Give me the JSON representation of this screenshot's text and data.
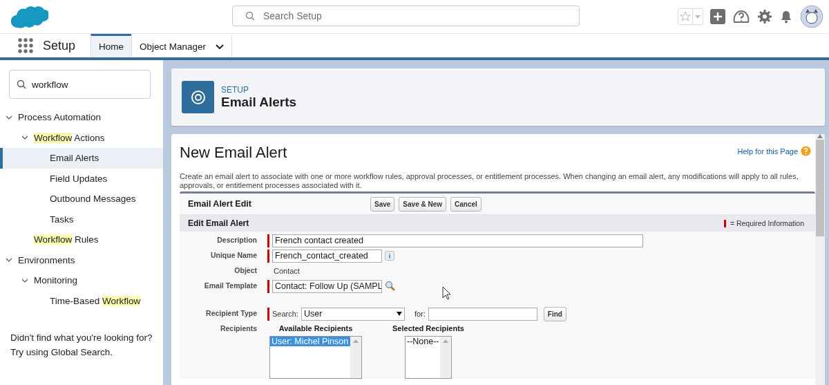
{
  "header": {
    "search": {
      "placeholder": "Search Setup"
    }
  },
  "nav": {
    "app_name": "Setup",
    "tabs": [
      {
        "label": "Home",
        "selected": true,
        "dropdown": false
      },
      {
        "label": "Object Manager",
        "selected": false,
        "dropdown": true
      }
    ]
  },
  "sidebar": {
    "search": {
      "value": "workflow"
    },
    "tree": [
      {
        "label": [
          {
            "text": "Process Automation",
            "highlight": false
          }
        ],
        "expanded": true,
        "selected": false,
        "children": [
          {
            "label": [
              {
                "text": "Workflow",
                "highlight": true
              },
              {
                "text": " Actions",
                "highlight": false
              }
            ],
            "expanded": true,
            "selected": false,
            "children": [
              {
                "label": [
                  {
                    "text": "Email Alerts",
                    "highlight": false
                  }
                ],
                "selected": true
              },
              {
                "label": [
                  {
                    "text": "Field Updates",
                    "highlight": false
                  }
                ],
                "selected": false
              },
              {
                "label": [
                  {
                    "text": "Outbound Messages",
                    "highlight": false
                  }
                ],
                "selected": false
              },
              {
                "label": [
                  {
                    "text": "Tasks",
                    "highlight": false
                  }
                ],
                "selected": false
              }
            ]
          },
          {
            "label": [
              {
                "text": "Workflow",
                "highlight": true
              },
              {
                "text": " Rules",
                "highlight": false
              }
            ],
            "selected": false
          }
        ]
      },
      {
        "label": [
          {
            "text": "Environments",
            "highlight": false
          }
        ],
        "expanded": true,
        "selected": false,
        "children": [
          {
            "label": [
              {
                "text": "Monitoring",
                "highlight": false
              }
            ],
            "expanded": true,
            "selected": false,
            "children": [
              {
                "label": [
                  {
                    "text": "Time-Based ",
                    "highlight": false
                  },
                  {
                    "text": "Workflow",
                    "highlight": true
                  }
                ],
                "selected": false
              }
            ]
          }
        ]
      }
    ],
    "footer": [
      "Didn't find what you're looking for?",
      "Try using Global Search."
    ]
  },
  "page_header": {
    "eyebrow": "SETUP",
    "title": "Email Alerts"
  },
  "form_page": {
    "title": "New Email Alert",
    "help_link": "Help for this Page",
    "intro": "Create an email alert to associate with one or more workflow rules, approval processes, or entitlement processes. When changing an email alert, any modifications will apply to all rules, approvals, or entitlement processes associated with it.",
    "block_title": "Email Alert Edit",
    "buttons": [
      "Save",
      "Save & New",
      "Cancel"
    ],
    "section_title": "Edit Email Alert",
    "required_legend": "= Required Information",
    "fields": [
      {
        "kind": "input",
        "label": "Description",
        "value": "French contact created",
        "required": true,
        "wide": true,
        "info": false
      },
      {
        "kind": "input",
        "label": "Unique Name",
        "value": "French_contact_created",
        "required": true,
        "wide": false,
        "info": true
      },
      {
        "kind": "text",
        "label": "Object",
        "value": "Contact",
        "required": false
      },
      {
        "kind": "lookup",
        "label": "Email Template",
        "value": "Contact: Follow Up (SAMPL",
        "required": true
      },
      {
        "kind": "recipient_type",
        "label": "Recipient Type",
        "required": true,
        "search_label": "Search:",
        "select_value": "User",
        "for_label": "for:",
        "find_button": "Find"
      },
      {
        "kind": "recipients",
        "label": "Recipients",
        "available_title": "Available Recipients",
        "available": [
          {
            "text": "User: Michel Pinson",
            "selected": true
          }
        ],
        "selected_title": "Selected Recipients",
        "selected_list": [
          {
            "text": "--None--",
            "selected": false
          }
        ]
      }
    ]
  }
}
